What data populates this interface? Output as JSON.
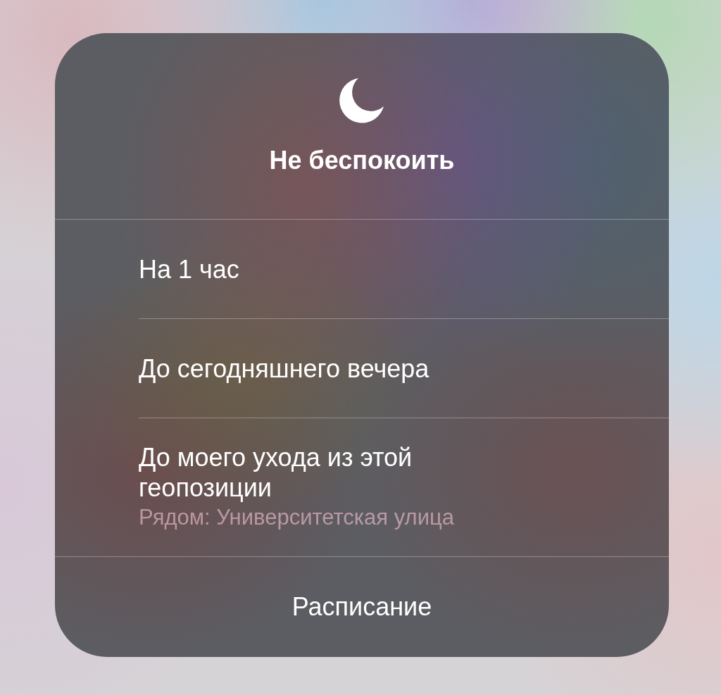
{
  "header": {
    "title": "Не беспокоить"
  },
  "options": [
    {
      "kind": "option",
      "label": "На 1 час"
    },
    {
      "kind": "option",
      "label": "До сегодняшнего вечера"
    },
    {
      "kind": "location",
      "label": "До моего ухода из этой геопозиции",
      "detail": "Рядом: Университетская улица"
    }
  ],
  "footer": {
    "label": "Расписание"
  }
}
